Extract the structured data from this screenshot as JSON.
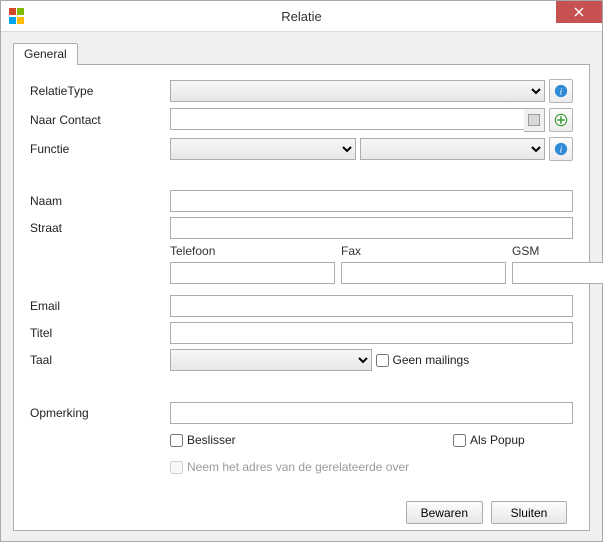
{
  "window": {
    "title": "Relatie"
  },
  "tabs": {
    "general": "General"
  },
  "labels": {
    "relatieType": "RelatieType",
    "naarContact": "Naar Contact",
    "functie": "Functie",
    "naam": "Naam",
    "straat": "Straat",
    "telefoon": "Telefoon",
    "fax": "Fax",
    "gsm": "GSM",
    "email": "Email",
    "titel": "Titel",
    "taal": "Taal",
    "opmerking": "Opmerking"
  },
  "values": {
    "relatieType": "",
    "naarContact": "",
    "functie1": "",
    "functie2": "",
    "naam": "",
    "straat": "",
    "telefoon": "",
    "fax": "",
    "gsm": "",
    "email": "",
    "titel": "",
    "taal": "",
    "opmerking": ""
  },
  "checks": {
    "geenMailings": "Geen mailings",
    "beslisser": "Beslisser",
    "alsPopup": "Als Popup",
    "neemAdres": "Neem het adres van de gerelateerde over"
  },
  "buttons": {
    "bewaren": "Bewaren",
    "sluiten": "Sluiten"
  }
}
